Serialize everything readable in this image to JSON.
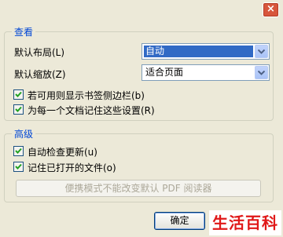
{
  "window": {
    "close_glyph": "×"
  },
  "view_group": {
    "title": "查看",
    "layout_label": "默认布局(L)",
    "layout_value": "自动",
    "zoom_label": "默认缩放(Z)",
    "zoom_value": "适合页面",
    "bookmarks_checkbox": {
      "label": "若可用则显示书签侧边栏(b)",
      "checked": true
    },
    "remember_per_doc_checkbox": {
      "label": "为每一个文档记住这些设置(R)",
      "checked": true
    }
  },
  "advanced_group": {
    "title": "高级",
    "auto_update_checkbox": {
      "label": "自动检查更新(u)",
      "checked": true
    },
    "remember_open_files_checkbox": {
      "label": "记住已打开的文件(o)",
      "checked": true
    },
    "default_reader_button": "便携模式不能改变默认 PDF 阅读器"
  },
  "footer": {
    "ok_button": "确定",
    "watermark": "生活百科"
  },
  "colors": {
    "accent": "#0046d5",
    "selection": "#316ac5",
    "watermark": "#e01818"
  }
}
